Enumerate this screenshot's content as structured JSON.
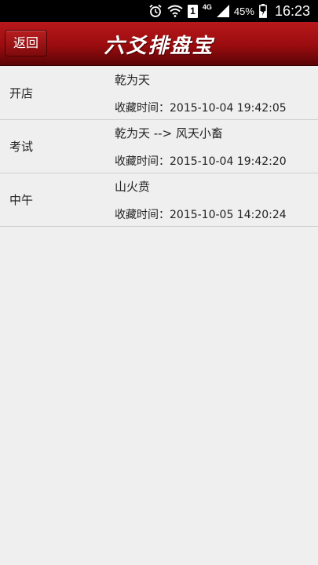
{
  "status_bar": {
    "sim_number": "1",
    "network_type": "4G",
    "battery_percent": "45%",
    "time": "16:23",
    "icons": [
      "alarm-icon",
      "wifi-icon",
      "signal-icon",
      "battery-charging-icon"
    ]
  },
  "header": {
    "back_label": "返回",
    "title": "六爻排盘宝",
    "background_color": "#9a0c0f"
  },
  "favorites": [
    {
      "name": "开店",
      "gua": "乾为天",
      "time": "收藏时间：2015-10-04 19:42:05"
    },
    {
      "name": "考试",
      "gua": "乾为天 --> 风天小畜",
      "time": "收藏时间：2015-10-04 19:42:20"
    },
    {
      "name": "中午",
      "gua": "山火贲",
      "time": "收藏时间：2015-10-05 14:20:24"
    }
  ]
}
